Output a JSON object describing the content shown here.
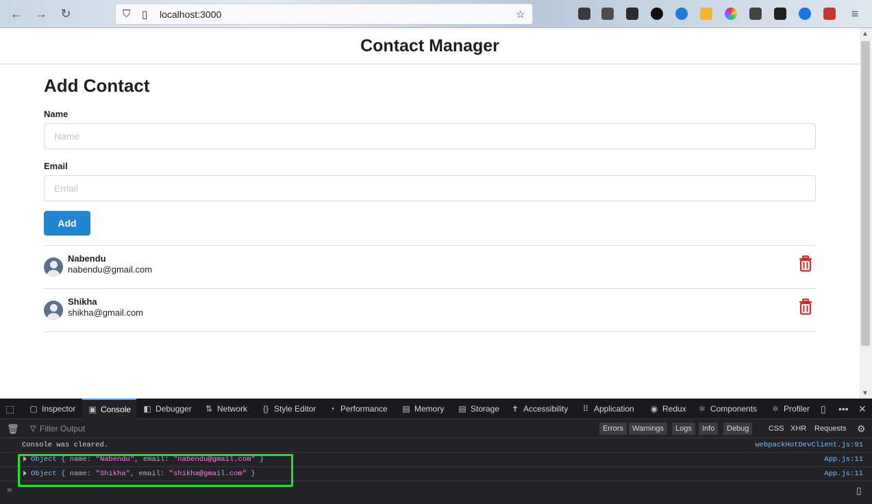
{
  "browser": {
    "url": "localhost:3000"
  },
  "app": {
    "title": "Contact Manager",
    "form": {
      "heading": "Add Contact",
      "name_label": "Name",
      "name_placeholder": "Name",
      "email_label": "Email",
      "email_placeholder": "Email",
      "add_label": "Add"
    },
    "contacts": [
      {
        "name": "Nabendu",
        "email": "nabendu@gmail.com"
      },
      {
        "name": "Shikha",
        "email": "shikha@gmail.com"
      }
    ]
  },
  "devtools": {
    "tabs": [
      "Inspector",
      "Console",
      "Debugger",
      "Network",
      "Style Editor",
      "Performance",
      "Memory",
      "Storage",
      "Accessibility",
      "Application",
      "Redux",
      "Components",
      "Profiler"
    ],
    "active_tab": "Console",
    "filter_placeholder": "Filter Output",
    "levels": [
      "Errors",
      "Warnings",
      "Logs",
      "Info",
      "Debug"
    ],
    "extra_filters": [
      "CSS",
      "XHR",
      "Requests"
    ],
    "console_rows": [
      {
        "message": "Console was cleared.",
        "source": "webpackHotDevClient.js:91"
      },
      {
        "message_prefix": "Object { ",
        "key1": "name: ",
        "val1": "\"Nabendu\"",
        "key2": ", email: ",
        "val2": "\"nabendu@gmail.com\"",
        "suffix": " }",
        "source": "App.js:11"
      },
      {
        "message_prefix": "Object { ",
        "key1": "name: ",
        "val1": "\"Shikha\"",
        "key2": ", email: ",
        "val2": "\"shikha@gmail.com\"",
        "suffix": " }",
        "source": "App.js:11"
      }
    ],
    "prompt": "»"
  },
  "colors": {
    "add_button": "#2185d0",
    "trash": "#db2828",
    "highlight_box": "#22e22a"
  }
}
